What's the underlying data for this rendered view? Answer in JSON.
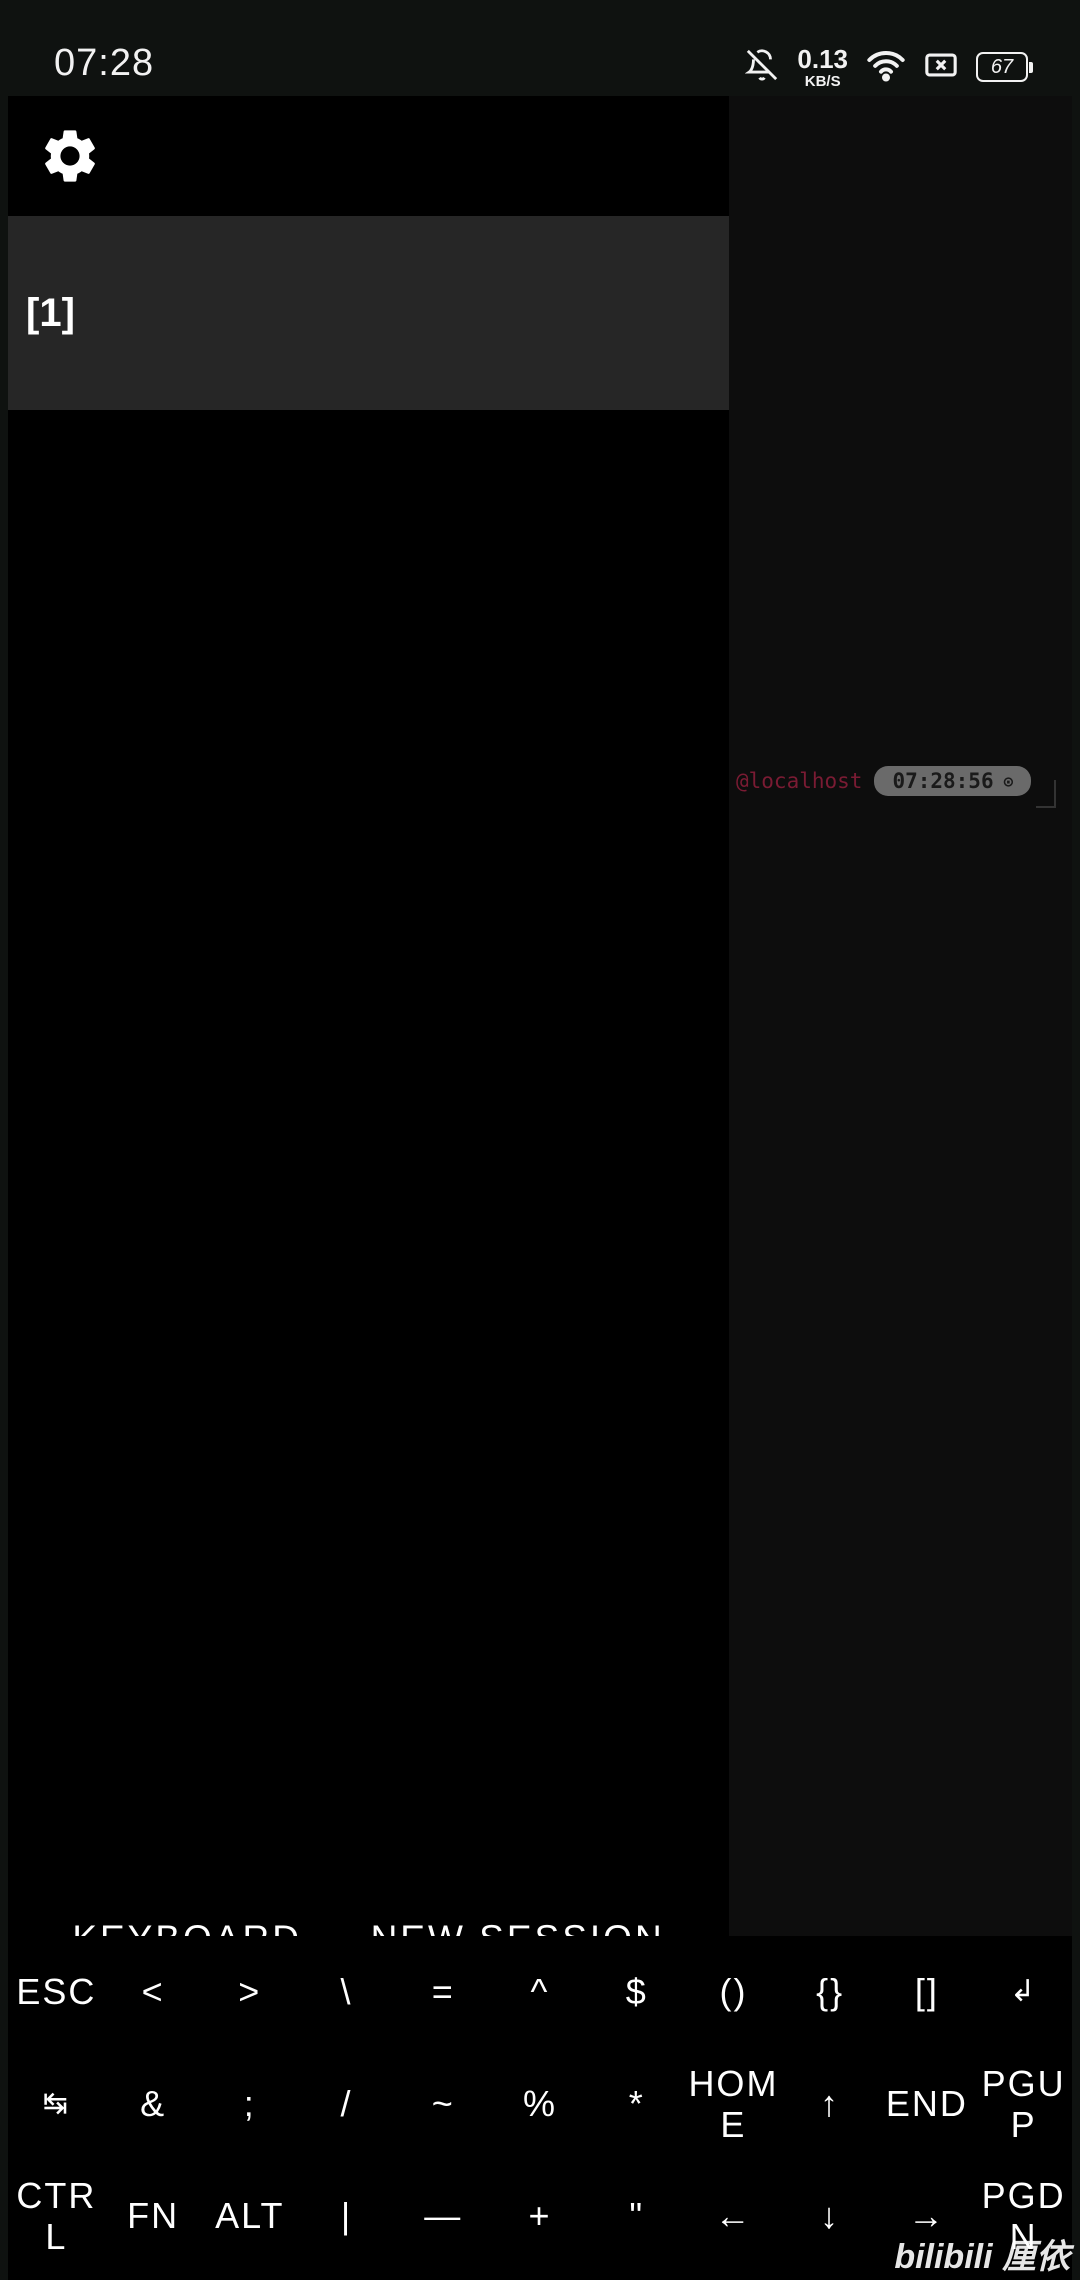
{
  "status_bar": {
    "time": "07:28",
    "net_speed_value": "0.13",
    "net_speed_unit": "KB/S",
    "battery": "67",
    "icons": [
      "bell-off-icon",
      "wifi-icon",
      "sim-off-icon",
      "battery-icon"
    ]
  },
  "terminal": {
    "prompt_host": "@localhost",
    "prompt_time": "07:28:56",
    "prompt_time_icon": "⊙"
  },
  "drawer": {
    "settings_icon": "gear-icon",
    "sessions": [
      {
        "label": "[1]"
      }
    ],
    "keyboard_label": "KEYBOARD",
    "new_session_label": "NEW SESSION"
  },
  "extra_keys": {
    "row1": [
      "ESC",
      "<",
      ">",
      "\\",
      "=",
      "^",
      "$",
      "()",
      "{}",
      "[]",
      "↲"
    ],
    "row2": [
      "↹",
      "&",
      ";",
      "/",
      "~",
      "%",
      "*",
      "HOM\nE",
      "↑",
      "END",
      "PGU\nP"
    ],
    "row3": [
      "CTR\nL",
      "FN",
      "ALT",
      "|",
      "—",
      "+",
      "\"",
      "←",
      "↓",
      "→",
      "PGD\nN"
    ]
  },
  "watermark": "bilibili 厘依"
}
